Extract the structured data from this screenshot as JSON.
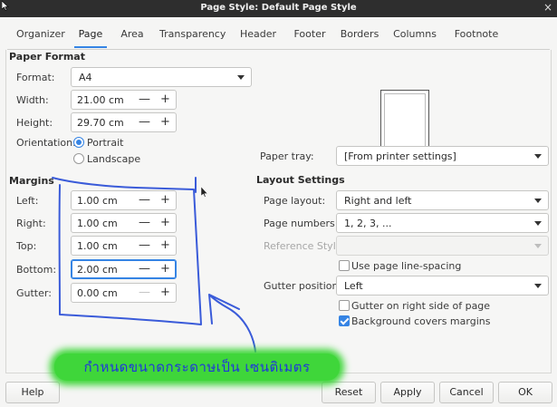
{
  "window": {
    "title": "Page Style: Default Page Style",
    "close_glyph": "×"
  },
  "tabs": [
    "Organizer",
    "Page",
    "Area",
    "Transparency",
    "Header",
    "Footer",
    "Borders",
    "Columns",
    "Footnote"
  ],
  "active_tab": "Page",
  "paper_format": {
    "title": "Paper Format",
    "format_label": "Format:",
    "format_value": "A4",
    "width_label": "Width:",
    "width_value": "21.00 cm",
    "height_label": "Height:",
    "height_value": "29.70 cm",
    "orientation_label": "Orientation:",
    "portrait_label": "Portrait",
    "landscape_label": "Landscape",
    "orientation_selected": "Portrait"
  },
  "paper_tray": {
    "label": "Paper tray:",
    "value": "[From printer settings]"
  },
  "margins": {
    "title": "Margins",
    "left_label": "Left:",
    "left_value": "1.00 cm",
    "right_label": "Right:",
    "right_value": "1.00 cm",
    "top_label": "Top:",
    "top_value": "1.00 cm",
    "bottom_label": "Bottom:",
    "bottom_value": "2.00 cm",
    "gutter_label": "Gutter:",
    "gutter_value": "0.00 cm"
  },
  "layout_settings": {
    "title": "Layout Settings",
    "page_layout_label": "Page layout:",
    "page_layout_value": "Right and left",
    "page_numbers_label": "Page numbers:",
    "page_numbers_value": "1, 2, 3, ...",
    "reference_style_label": "Reference Style:",
    "reference_style_value": "",
    "use_line_spacing_label": "Use page line-spacing",
    "use_line_spacing_checked": false,
    "gutter_position_label": "Gutter position:",
    "gutter_position_value": "Left",
    "gutter_right_label": "Gutter on right side of page",
    "gutter_right_checked": false,
    "background_covers_label": "Background covers margins",
    "background_covers_checked": true
  },
  "spin_glyphs": {
    "minus": "—",
    "plus": "+"
  },
  "buttons": {
    "help": "Help",
    "reset": "Reset",
    "apply": "Apply",
    "cancel": "Cancel",
    "ok": "OK"
  },
  "annotation": {
    "note": "กำหนดขนาดกระดาษเป็น เซนติเมตร",
    "ink_color": "#3a5bd9",
    "highlight_color": "#3fd63a"
  }
}
